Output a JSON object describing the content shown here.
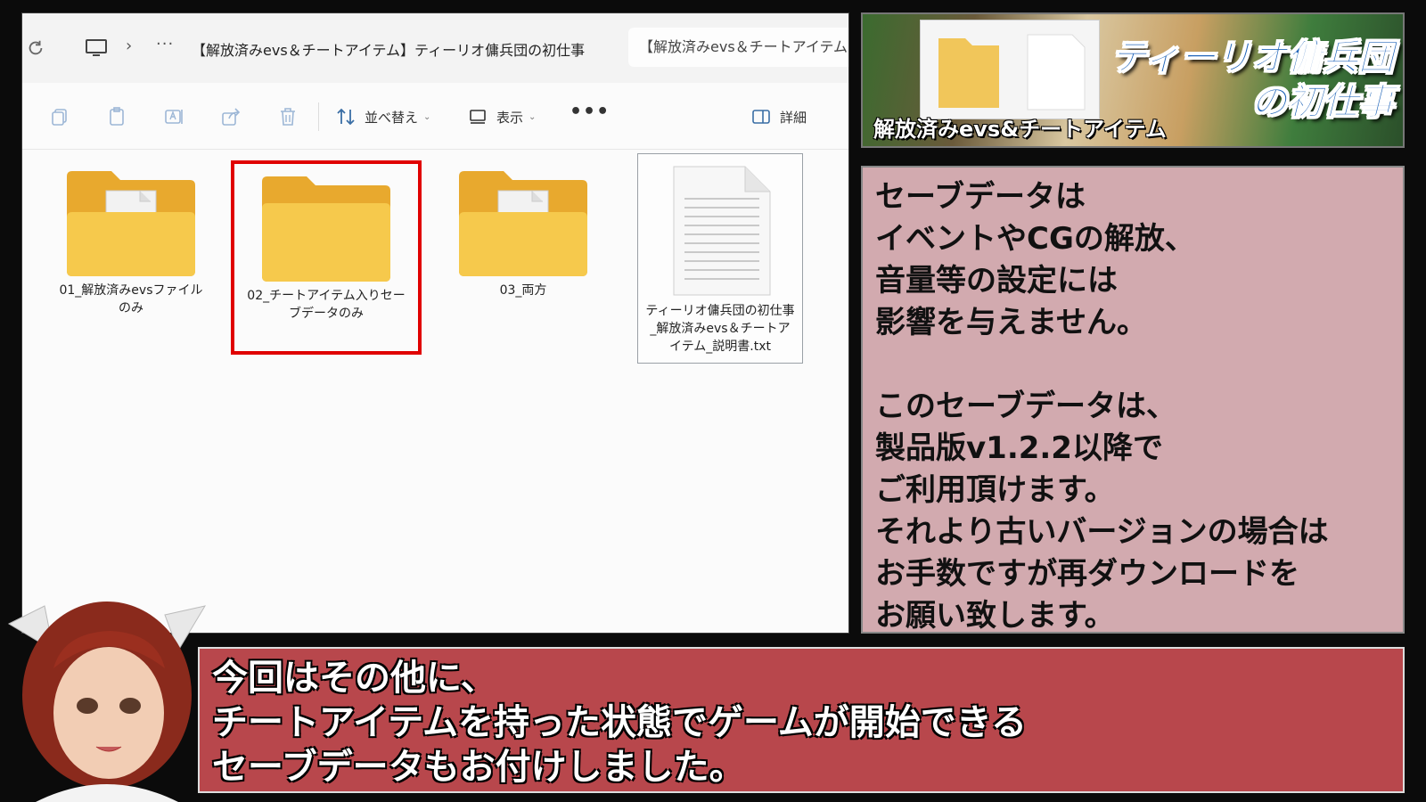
{
  "explorer": {
    "address_path": "【解放済みevs＆チートアイテム】ティーリオ傭兵団の初仕事",
    "second_tab": "【解放済みevs＆チートアイテム",
    "toolbar": {
      "sort_label": "並べ替え",
      "view_label": "表示",
      "more_label": "•••",
      "details_label": "詳細"
    },
    "items": [
      {
        "label_line1": "01_解放済みevsファイル",
        "label_line2": "のみ",
        "label_line3": ""
      },
      {
        "label_line1": "02_チートアイテム入りセー",
        "label_line2": "ブデータのみ",
        "label_line3": ""
      },
      {
        "label_line1": "03_両方",
        "label_line2": "",
        "label_line3": ""
      },
      {
        "label_line1": "ティーリオ傭兵団の初仕事",
        "label_line2": "_解放済みevs＆チートア",
        "label_line3": "イテム_説明書.txt"
      }
    ]
  },
  "banner": {
    "title_line1": "ティーリオ傭兵団",
    "title_line2": "の初仕事",
    "subtitle": "解放済みevs&チートアイテム"
  },
  "note": {
    "lines": [
      "セーブデータは",
      "イベントやCGの解放、",
      "音量等の設定には",
      "影響を与えません。",
      "",
      "このセーブデータは、",
      "製品版v1.2.2以降で",
      "ご利用頂けます。",
      "それより古いバージョンの場合は",
      "お手数ですが再ダウンロードを",
      "お願い致します。"
    ]
  },
  "subtitle": {
    "lines": [
      "今回はその他に、",
      "チートアイテムを持った状態でゲームが開始できる",
      "セーブデータもお付けしました。"
    ]
  },
  "colors": {
    "highlight_border": "#e00000",
    "note_bg": "#d2aaaf",
    "subtitle_bg": "#b8474c",
    "folder_yellow": "#f6c94c"
  }
}
